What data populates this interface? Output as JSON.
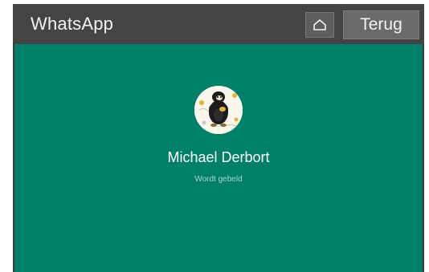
{
  "header": {
    "title": "WhatsApp",
    "home_icon": "home-icon",
    "back_label": "Terug"
  },
  "call": {
    "contact_name": "Michael Derbort",
    "status": "Wordt gebeld",
    "avatar": "contact-avatar"
  },
  "colors": {
    "header_bg": "#444444",
    "call_bg": "#008069",
    "status_text": "#a6d8cc"
  }
}
